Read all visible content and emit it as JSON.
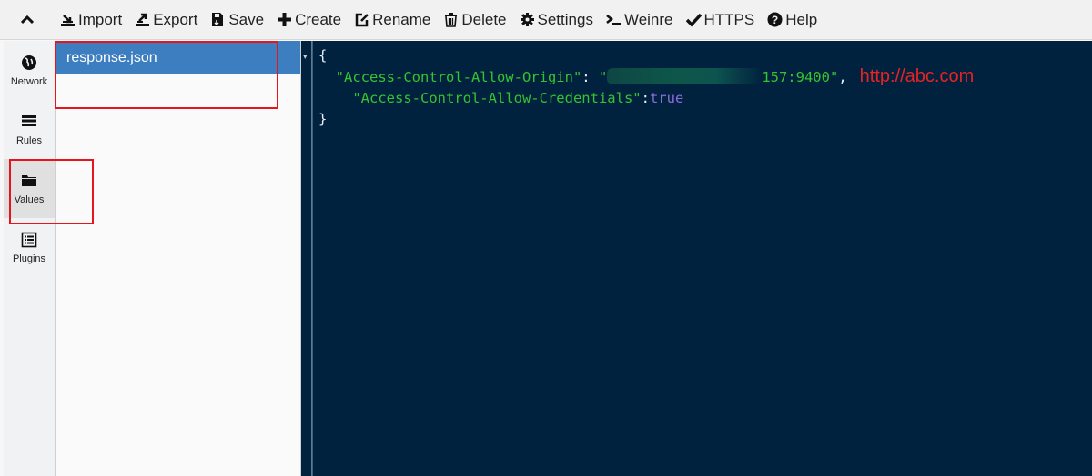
{
  "toolbar": {
    "collapse_icon": "chevron-up-icon",
    "items": [
      {
        "label": "Import",
        "icon": "import-icon"
      },
      {
        "label": "Export",
        "icon": "export-icon"
      },
      {
        "label": "Save",
        "icon": "save-icon"
      },
      {
        "label": "Create",
        "icon": "plus-icon"
      },
      {
        "label": "Rename",
        "icon": "edit-icon"
      },
      {
        "label": "Delete",
        "icon": "trash-icon"
      },
      {
        "label": "Settings",
        "icon": "gear-icon"
      },
      {
        "label": "Weinre",
        "icon": "terminal-icon"
      },
      {
        "label": "HTTPS",
        "icon": "check-icon"
      },
      {
        "label": "Help",
        "icon": "question-circle-icon"
      }
    ]
  },
  "sidebar": {
    "items": [
      {
        "label": "Network",
        "icon": "globe-icon",
        "active": false
      },
      {
        "label": "Rules",
        "icon": "list-icon",
        "active": false
      },
      {
        "label": "Values",
        "icon": "folder-icon",
        "active": true
      },
      {
        "label": "Plugins",
        "icon": "plugin-list-icon",
        "active": false
      }
    ]
  },
  "filelist": {
    "items": [
      {
        "name": "response.json",
        "selected": true
      }
    ]
  },
  "editor": {
    "open_brace": "{",
    "close_brace": "}",
    "line1_key": "\"Access-Control-Allow-Origin\"",
    "line1_colon": ": ",
    "line1_value_start": "\"",
    "line1_value_end": "157:9400\"",
    "line1_comma": ",",
    "line2_key": "\"Access-Control-Allow-Credentials\"",
    "line2_colon": ":",
    "line2_value": "true",
    "annotation": "http://abc.com",
    "fold_marker": "▾"
  },
  "colors": {
    "accent": "#3c7ebf",
    "editor_bg": "#01223f",
    "string": "#35c32f",
    "boolean": "#8b6be0",
    "highlight_box": "#e8141c"
  }
}
